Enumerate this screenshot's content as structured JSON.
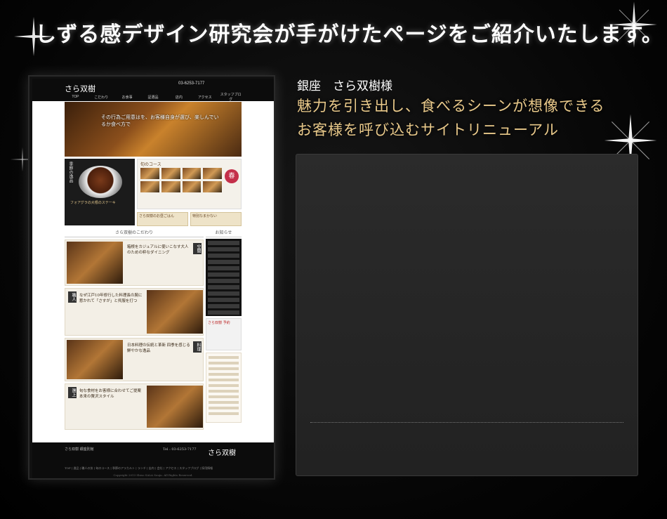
{
  "page": {
    "heading": "しずる感デザイン研究会が手がけたページをご紹介いたします。"
  },
  "work": {
    "client_name": "銀座　さら双樹様",
    "tagline_lines": [
      "魅力を引き出し、食べるシーンが想像できる",
      "お客様を呼び込むサイトリニューアル"
    ]
  },
  "screenshot": {
    "logo": "さら双樹",
    "tel": "03-6253-7177",
    "nav": [
      "TOP",
      "こだわり",
      "お食事",
      "証選品",
      "店内",
      "アクセス",
      "スタッフブログ"
    ],
    "hero_text": "その行為ご用意はを、お客様自身が選び、楽しんでいるか食べ方で",
    "left_title": "季節の逸品",
    "left_caption": "フォアグラの大根のステーキ",
    "course_title": "旬のコース",
    "season_badge": "春",
    "banners": [
      "さら双樹のお昼ごはん",
      "特別なまかない"
    ],
    "section_title": "さら双樹のこだわり",
    "news_title": "お知らせ",
    "features": [
      {
        "tag": "空間",
        "text": "箱根をカジュアルに使いこなす大人のための粋なダイニング"
      },
      {
        "tag": "職人",
        "text": "なぜ江戸10年修行した料理長の腕に惹かれて「さすが」と呉服を打つ"
      },
      {
        "tag": "料理",
        "text": "日本料理の伝統と革新 四季を感じる鮮やかな逸品"
      },
      {
        "tag": "選上",
        "text": "旬な食材をお客様に合わせてご提案 本来の贅沢スタイル"
      }
    ],
    "side_reserve": "さら双樹 予約",
    "footer_info": "さら双樹 銀座別館",
    "footer_tel": "Tel : 03-6253-7177",
    "footer_logo": "さら双樹",
    "footer_links": "TOP | 逸品 | 職人の技 | 旬のコース | 季節のアラカルト | ランチ | 店内 | 会社 | アクセス | スタッフブログ | 採用情報",
    "footer_copy": "Copyright 2013 Shiso SALA Souju. All Rights Reserved."
  },
  "colors": {
    "accent_gold": "#e9c98a",
    "panel": "#2b2b2b"
  }
}
